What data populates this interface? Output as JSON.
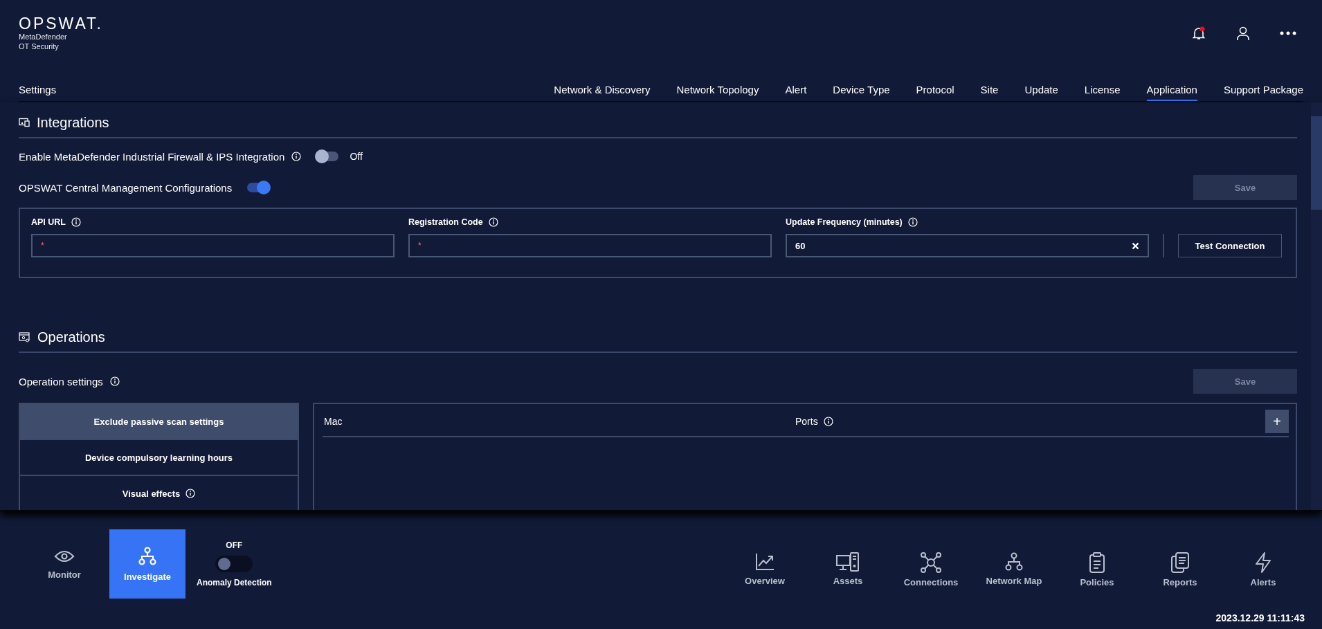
{
  "logo": {
    "brand": "OPSWAT.",
    "product_line1": "MetaDefender",
    "product_line2": "OT Security"
  },
  "notification": {
    "unread": true
  },
  "page_title": "Settings",
  "tabs": [
    {
      "label": "Network & Discovery",
      "selected": false
    },
    {
      "label": "Network Topology",
      "selected": false
    },
    {
      "label": "Alert",
      "selected": false
    },
    {
      "label": "Device Type",
      "selected": false
    },
    {
      "label": "Protocol",
      "selected": false
    },
    {
      "label": "Site",
      "selected": false
    },
    {
      "label": "Update",
      "selected": false
    },
    {
      "label": "License",
      "selected": false
    },
    {
      "label": "Application",
      "selected": true
    },
    {
      "label": "Support Package",
      "selected": false
    }
  ],
  "integrations": {
    "title": "Integrations",
    "firewall_toggle": {
      "label": "Enable MetaDefender Industrial Firewall & IPS Integration",
      "on": false,
      "state_text": "Off"
    },
    "central_management": {
      "label": "OPSWAT Central Management Configurations",
      "on": true
    },
    "save_button": {
      "label": "Save",
      "disabled": true
    },
    "fields": [
      {
        "label": "API URL",
        "required_mark": "*"
      },
      {
        "label": "Registration Code",
        "required_mark": "*"
      },
      {
        "label": "Update Frequency (minutes)",
        "value": "60",
        "clearable": true
      }
    ],
    "test_button": "Test Connection"
  },
  "operations": {
    "title": "Operations",
    "settings_label": "Operation settings",
    "save_button": {
      "label": "Save",
      "disabled": true
    },
    "menu": [
      {
        "label": "Exclude passive scan settings",
        "selected": true,
        "info": false
      },
      {
        "label": "Device compulsory learning hours",
        "selected": false,
        "info": false
      },
      {
        "label": "Visual effects",
        "selected": false,
        "info": true
      }
    ],
    "columns": [
      {
        "label": "Mac",
        "info": false
      },
      {
        "label": "Ports",
        "info": true
      }
    ],
    "add_button": "+"
  },
  "modes": [
    {
      "label": "Monitor",
      "kind": "eye",
      "selected": false
    },
    {
      "label": "Investigate",
      "kind": "tree",
      "selected": true
    }
  ],
  "anomaly": {
    "state_text": "OFF",
    "on": false,
    "label": "Anomaly Detection"
  },
  "nav": [
    {
      "label": "Overview",
      "kind": "chart"
    },
    {
      "label": "Assets",
      "kind": "assets"
    },
    {
      "label": "Connections",
      "kind": "hub"
    },
    {
      "label": "Network Map",
      "kind": "tree"
    },
    {
      "label": "Policies",
      "kind": "clipboard"
    },
    {
      "label": "Reports",
      "kind": "docs"
    },
    {
      "label": "Alerts",
      "kind": "bolt"
    }
  ],
  "timestamp": "2023.12.29 11:11:43"
}
